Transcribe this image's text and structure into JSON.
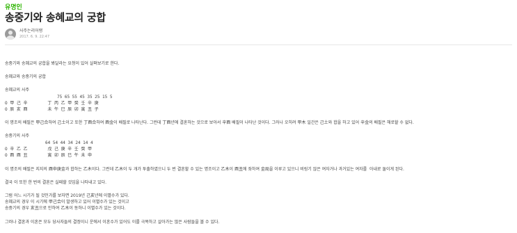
{
  "header": {
    "category": "유명인",
    "title": "송중기와 송혜교의 궁합",
    "author": "사주는리어랭",
    "date": "2017. 6. 9. 22:47"
  },
  "body": {
    "intro": "송중기와 송혜교의 궁합을 봐달라는 요청이 있어 살펴보기로 한다.",
    "subtitle": "송혜교와 송중기의 궁합",
    "saju1_heading": "송혜교의 사주",
    "saju1_daeun": "75 65 55 45 35 25 15 5",
    "saju1_row1": "O 甲 己 辛        丁 丙 乙 甲 癸 壬 辛 庚",
    "saju1_row2": "O 辰 亥 酉        未 午 巳 辰 卯 寅 丑 子",
    "analysis1": "이 명조의 배필은 甲己合하여 己土이고 또한 丁酉合하여 酉金이 배필로 나타난다. 그런데 丁酉년에 결혼하는 것으로 보아서 辛酉 배필이 나타난 것이다. 그러나 오히려 甲木 일간은 己土와 합을 하고 있어 辛金의 배필은 해로할 수 없다.",
    "saju2_heading": "송중기의 사주",
    "saju2_daeun": "64 54 44 34 24 14 4",
    "saju2_row1": "O 辛 乙 乙        戊 己 庚 辛 壬 癸 甲",
    "saju2_row2": "O 酉 酉 丑        寅 卯 辰 巳 午 未 申",
    "analysis2": "이 명조의 배필은 지지의 酉申庚金과 합하는 乙木이다. 그런데 乙木이 두 개가 투출하였으니 두 번 결혼할 수 있는 명조이고 乙木이 酉丑에 좌하여 金局을 이루고 있으니 비링기 않은 여자거나 과거있는 여자를  아내로 둘이게 된다.",
    "conclusion": "결국 이 또한 한 번의 결혼은 실패할 것임을 나타내고 있다.",
    "p1": "그럼 어느 시기가 될 것인가를 보자면 2019년 己亥년에 이별수가 있다.",
    "p2": "송혜교의 경우 이 시기에 甲己合이 발생하고 있어 이별수가 있는 것이고",
    "p3": "송중기의 경우 亥丑으로 인하여 乙木이 동하니 이별수가 있는 것이다.",
    "closing": "그러나 결혼과 이혼은 모두 당사자들의 결정이니 운에서 이혼수가 있어도 이를 극복하고 살아가는 많은 사람들을 볼 수 있다."
  }
}
